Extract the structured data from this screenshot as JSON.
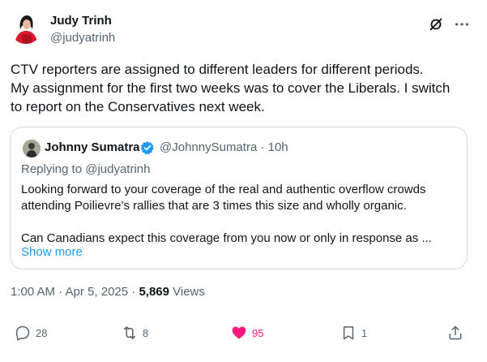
{
  "author": {
    "name": "Judy Trinh",
    "handle": "@judyatrinh"
  },
  "tweet": {
    "lines": [
      "CTV reporters are assigned to different leaders for different periods.",
      "My assignment for the first two weeks was to cover the Liberals. I switch",
      "to report on the Conservatives next week."
    ]
  },
  "quoted": {
    "name": "Johnny Sumatra",
    "handle_time": "@JohnnySumatra · 10h",
    "replying_prefix": "Replying to ",
    "replying_handle": "@judyatrinh",
    "lines": [
      "Looking forward to your coverage of the real and authentic overflow crowds",
      "attending Poilievre’s rallies that are 3 times this size and wholly organic.",
      "",
      "Can Canadians expect this coverage from you now or only in response as ..."
    ],
    "show_more": "Show more"
  },
  "meta": {
    "time_date": "1:00 AM · Apr 5, 2025 · ",
    "views": "5,869",
    "views_label": " Views"
  },
  "actions": {
    "replies": "28",
    "reposts": "8",
    "likes": "95",
    "bookmarks": "1"
  },
  "colors": {
    "accent": "#1d9bf0",
    "like": "#f91880",
    "muted": "#536471",
    "text": "#0f1419",
    "border": "#cfd9de"
  },
  "icons": [
    "grok-icon",
    "more-icon",
    "verified-badge-icon",
    "reply-icon",
    "repost-icon",
    "heart-icon",
    "bookmark-icon",
    "share-icon"
  ]
}
